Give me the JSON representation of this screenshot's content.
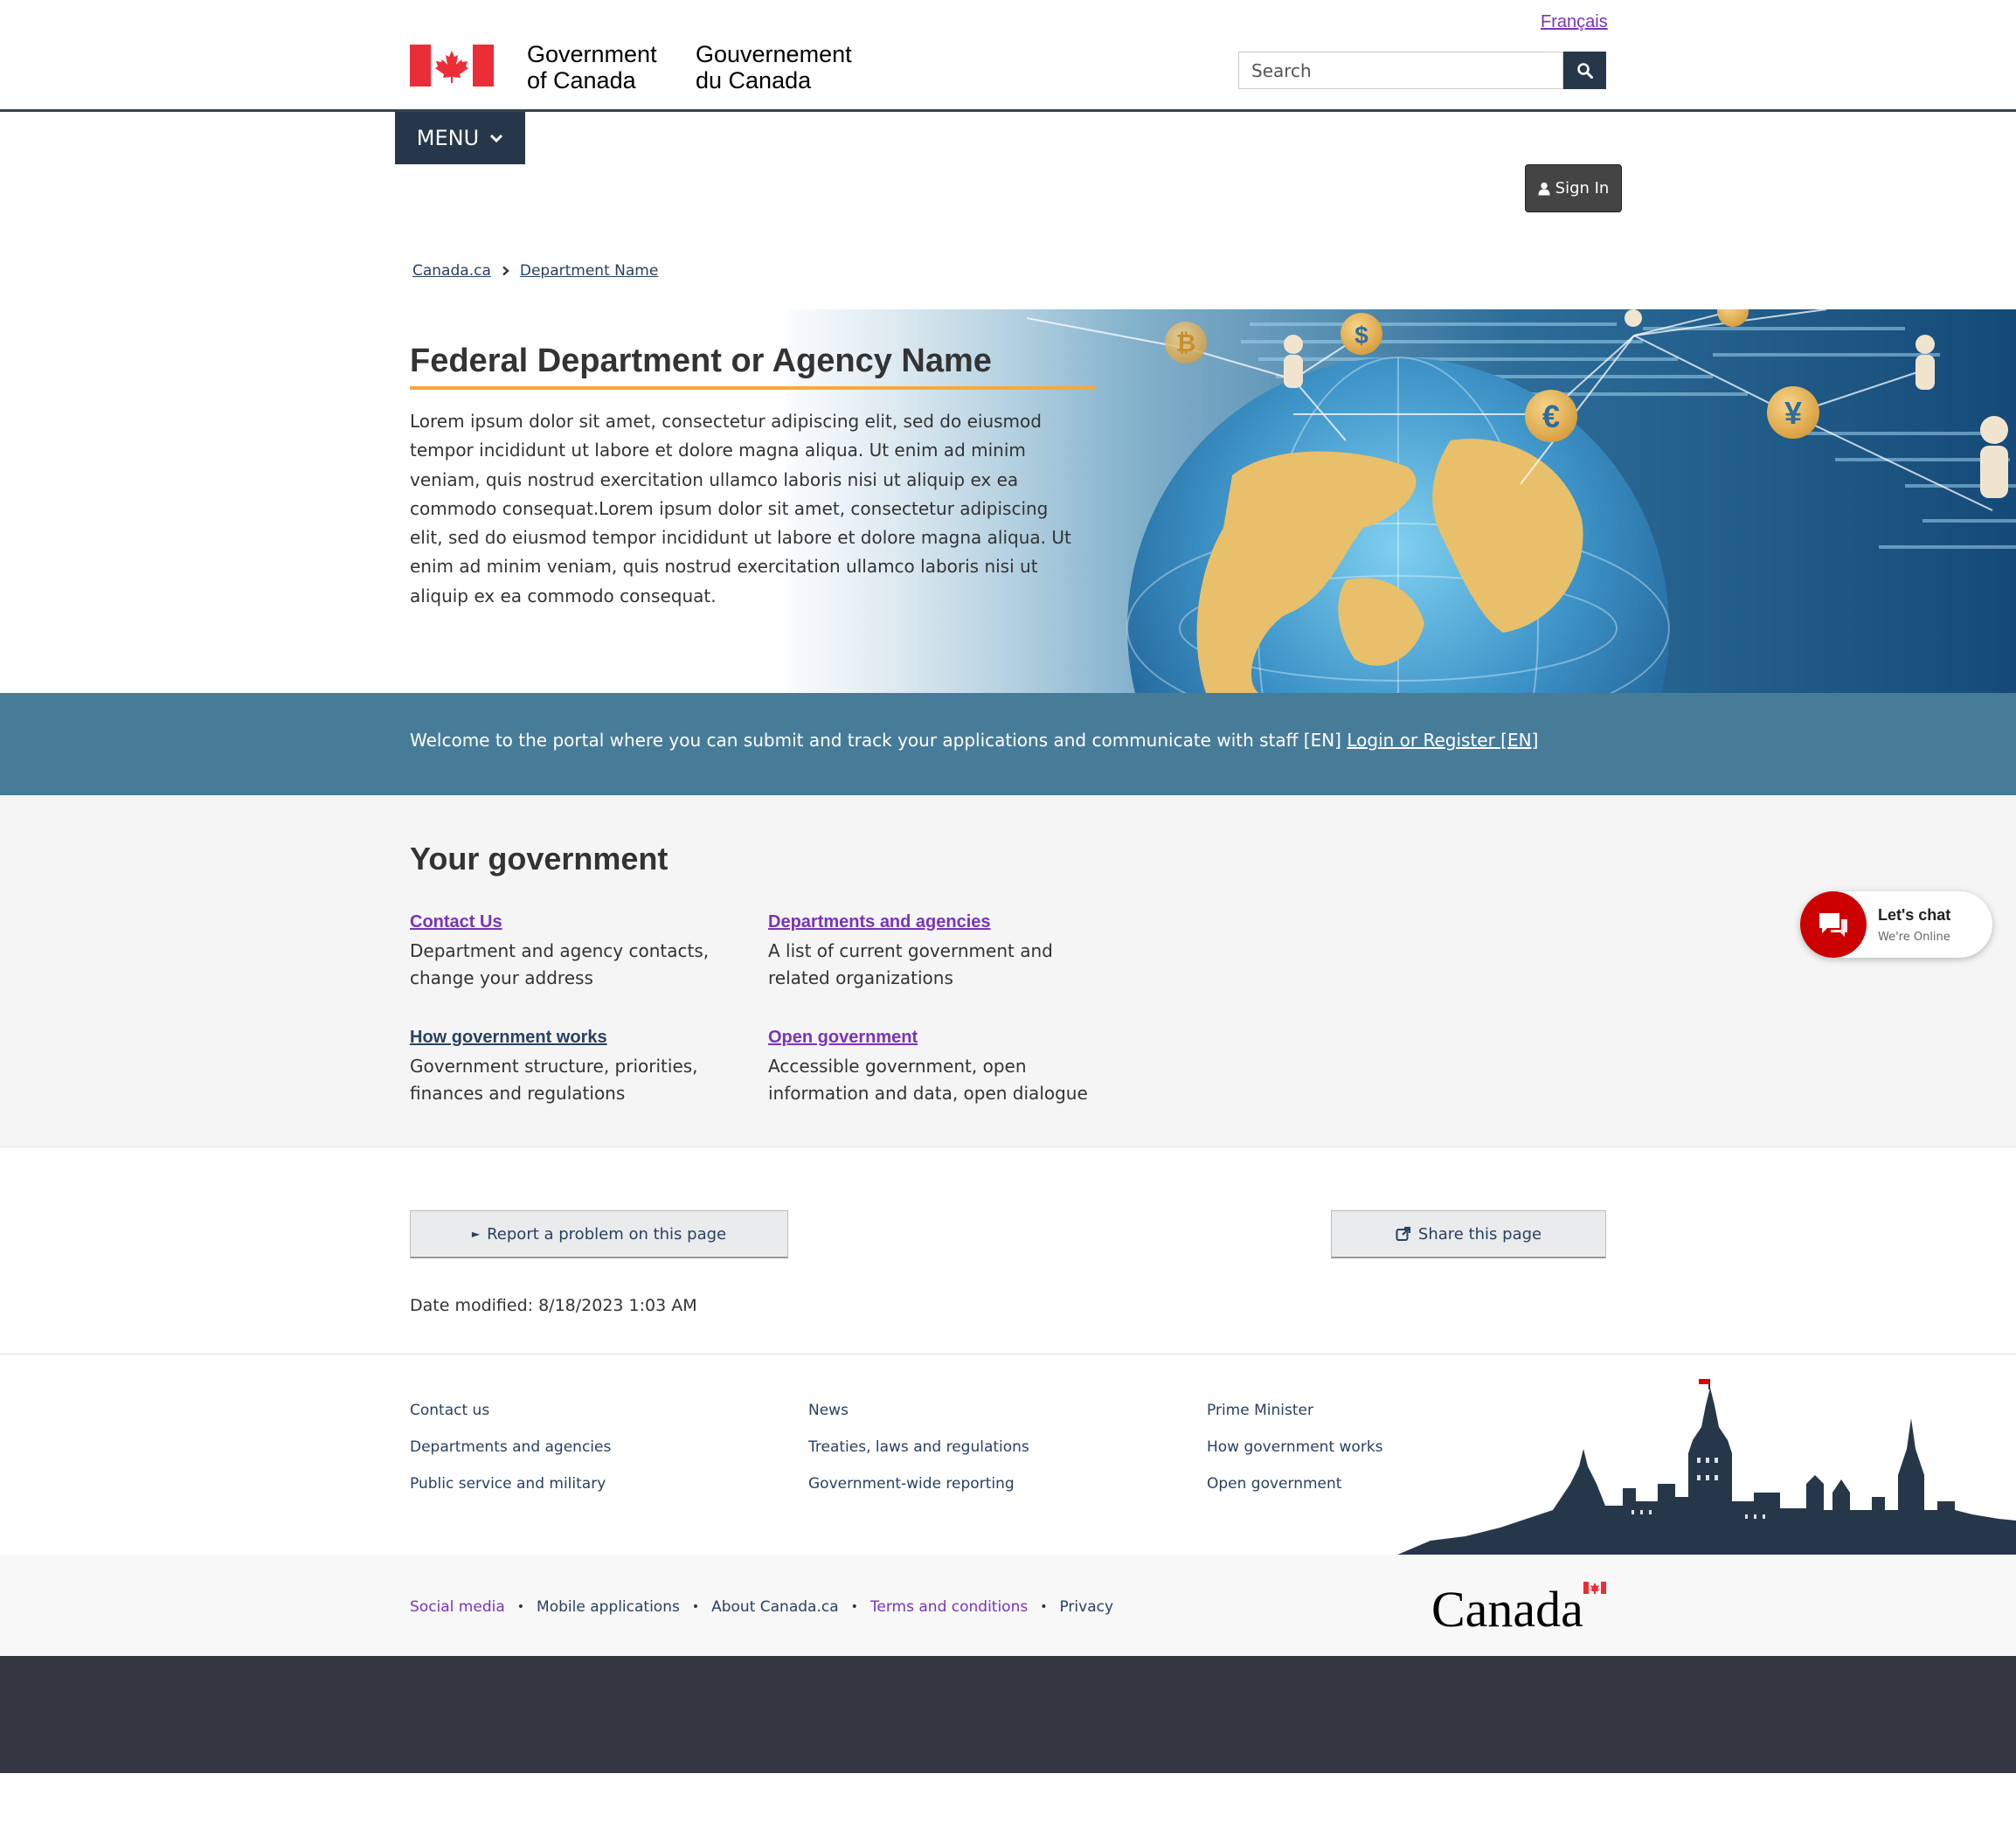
{
  "header": {
    "language_toggle": "Français",
    "signature_en_line1": "Government",
    "signature_en_line2": "of Canada",
    "signature_fr_line1": "Gouvernement",
    "signature_fr_line2": "du Canada",
    "search_placeholder": "Search"
  },
  "nav": {
    "menu_label": "MENU",
    "signin_label": "Sign In"
  },
  "breadcrumb": [
    "Canada.ca",
    "Department Name"
  ],
  "hero": {
    "title": "Federal Department or Agency Name",
    "body": "Lorem ipsum dolor sit amet, consectetur adipiscing elit, sed do eiusmod tempor incididunt ut labore et dolore magna aliqua. Ut enim ad minim veniam, quis nostrud exercitation ullamco laboris nisi ut aliquip ex ea commodo consequat.Lorem ipsum dolor sit amet, consectetur adipiscing elit, sed do eiusmod tempor incididunt ut labore et dolore magna aliqua. Ut enim ad minim veniam, quis nostrud exercitation ullamco laboris nisi ut aliquip ex ea commodo consequat."
  },
  "portal": {
    "text": "Welcome to the portal where you can submit and track your applications and communicate with staff [EN] ",
    "link": "Login or Register [EN]"
  },
  "your_government": {
    "heading": "Your government",
    "items": [
      {
        "title": "Contact Us",
        "desc_line1": "Department and agency contacts,",
        "desc_line2": "change your address"
      },
      {
        "title": "Departments and agencies",
        "desc_line1": "A list of current government and",
        "desc_line2": "related organizations"
      },
      {
        "title": "How government works",
        "desc_line1": "Government structure, priorities,",
        "desc_line2": "finances and regulations"
      },
      {
        "title": "Open government",
        "desc_line1": "Accessible government, open",
        "desc_line2": "information and data, open dialogue"
      }
    ]
  },
  "chat": {
    "title": "Let's chat",
    "status": "We're Online"
  },
  "page_details": {
    "report_label": "Report a problem on this page",
    "share_label": "Share this page",
    "date_modified": "Date modified: 8/18/2023 1:03 AM"
  },
  "footer": {
    "col1": [
      "Contact us",
      "Departments and agencies",
      "Public service and military"
    ],
    "col2": [
      "News",
      "Treaties, laws and regulations",
      "Government-wide reporting"
    ],
    "col3": [
      "Prime Minister",
      "How government works",
      "Open government"
    ],
    "sub_links": [
      "Social media",
      "Mobile applications",
      "About Canada.ca",
      "Terms and conditions",
      "Privacy"
    ],
    "wordmark": "Canada"
  },
  "colors": {
    "brand_navy": "#26374a",
    "visited_link": "#7834bc",
    "link": "#284162",
    "accent_underline": "#f6a93b",
    "portal_banner": "#477c99",
    "chat_red": "#cc0000",
    "footer_dark": "#333741"
  }
}
